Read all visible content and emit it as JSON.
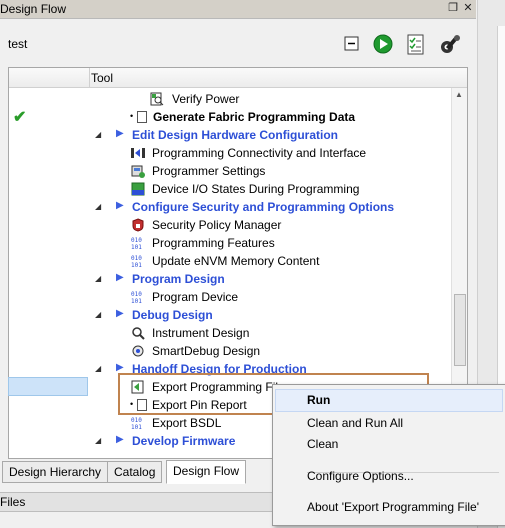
{
  "window": {
    "title": "Design Flow",
    "float_icon": "restore-icon",
    "close_icon": "close-icon"
  },
  "project": {
    "name": "test"
  },
  "toolbar": {
    "icons": [
      "collapse-icon",
      "run-icon",
      "report-icon",
      "configure-icon"
    ]
  },
  "tree": {
    "column_header": "Tool",
    "rows": [
      {
        "label": "Verify Power",
        "icon": "verify-power-icon"
      },
      {
        "label": "Generate Fabric Programming Data",
        "status": "checkmark-icon"
      },
      {
        "label": "Edit Design Hardware Configuration"
      },
      {
        "label": "Programming Connectivity and Interface"
      },
      {
        "label": "Programmer Settings"
      },
      {
        "label": "Device I/O States During Programming"
      },
      {
        "label": "Configure Security and Programming Options"
      },
      {
        "label": "Security Policy Manager"
      },
      {
        "label": "Programming Features"
      },
      {
        "label": "Update eNVM Memory Content"
      },
      {
        "label": "Program Design"
      },
      {
        "label": "Program Device"
      },
      {
        "label": "Debug Design"
      },
      {
        "label": "Instrument Design"
      },
      {
        "label": "SmartDebug Design"
      },
      {
        "label": "Handoff Design for Production"
      },
      {
        "label": "Export Programming File"
      },
      {
        "label": "Export Pin Report"
      },
      {
        "label": "Export BSDL"
      },
      {
        "label": "Develop Firmware"
      }
    ]
  },
  "tabs": [
    {
      "label": "Design Hierarchy"
    },
    {
      "label": "Catalog"
    },
    {
      "label": "Design Flow"
    }
  ],
  "files_panel": {
    "title": "Files"
  },
  "context_menu": {
    "items": [
      "Run",
      "Clean and Run All",
      "Clean",
      "Configure Options...",
      "About 'Export Programming File'"
    ]
  },
  "colors": {
    "category": "#2d4fd6",
    "highlight_border": "#c0834f",
    "check": "#2a9d2a"
  }
}
